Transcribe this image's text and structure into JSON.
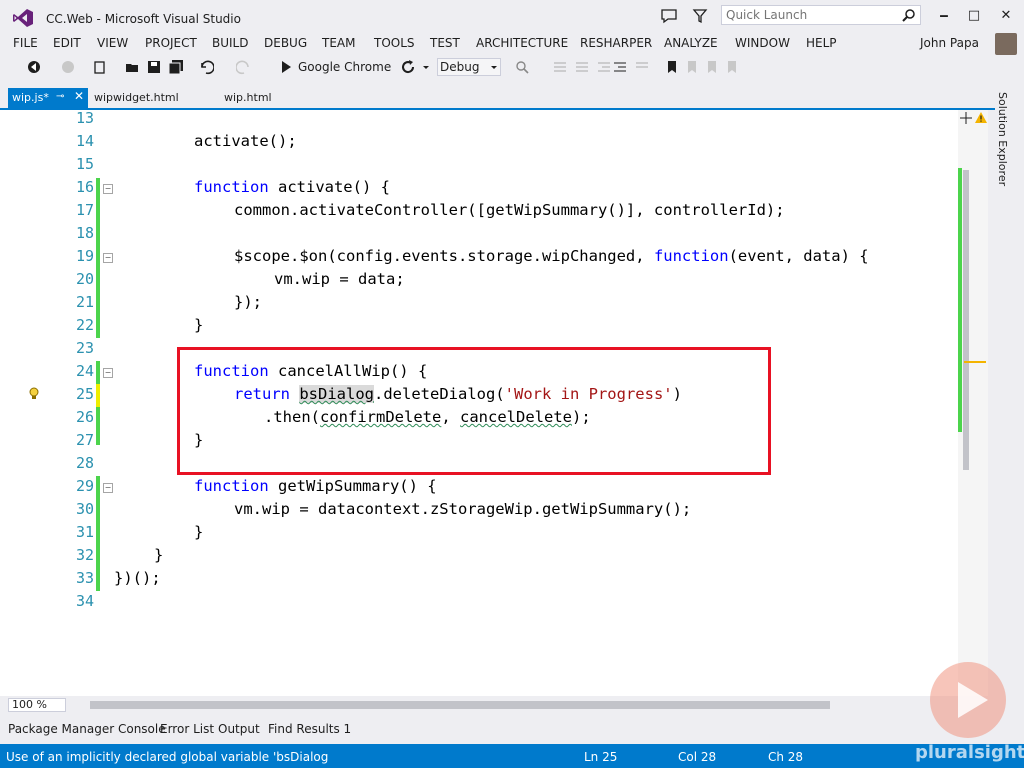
{
  "window": {
    "title": "CC.Web - Microsoft Visual Studio",
    "quick_launch_placeholder": "Quick Launch",
    "minimize": "🗕",
    "maximize": "□",
    "close": "✕"
  },
  "menu": [
    "FILE",
    "EDIT",
    "VIEW",
    "PROJECT",
    "BUILD",
    "DEBUG",
    "TEAM",
    "TOOLS",
    "TEST",
    "ARCHITECTURE",
    "RESHARPER",
    "ANALYZE",
    "WINDOW",
    "HELP"
  ],
  "user": "John Papa",
  "toolbar": {
    "browser": "Google Chrome",
    "config": "Debug"
  },
  "tabs": [
    {
      "label": "wip.js*",
      "active": true
    },
    {
      "label": "wipwidget.html",
      "active": false
    },
    {
      "label": "wip.html",
      "active": false
    }
  ],
  "side_panel": "Solution Explorer",
  "editor": {
    "lines": [
      {
        "n": "13",
        "code": ""
      },
      {
        "n": "14",
        "code": "activate();"
      },
      {
        "n": "15",
        "code": ""
      },
      {
        "n": "16",
        "code": "function activate() {"
      },
      {
        "n": "17",
        "code": "common.activateController([getWipSummary()], controllerId);"
      },
      {
        "n": "18",
        "code": ""
      },
      {
        "n": "19",
        "code": "$scope.$on(config.events.storage.wipChanged, function(event, data) {"
      },
      {
        "n": "20",
        "code": "vm.wip = data;"
      },
      {
        "n": "21",
        "code": "});"
      },
      {
        "n": "22",
        "code": "}"
      },
      {
        "n": "23",
        "code": ""
      },
      {
        "n": "24",
        "code": "function cancelAllWip() {"
      },
      {
        "n": "25",
        "code": "return bsDialog.deleteDialog('Work in Progress')"
      },
      {
        "n": "26",
        "code": ".then(confirmDelete, cancelDelete);"
      },
      {
        "n": "27",
        "code": "}"
      },
      {
        "n": "28",
        "code": ""
      },
      {
        "n": "29",
        "code": "function getWipSummary() {"
      },
      {
        "n": "30",
        "code": "vm.wip = datacontext.zStorageWip.getWipSummary();"
      },
      {
        "n": "31",
        "code": "}"
      },
      {
        "n": "32",
        "code": "}"
      },
      {
        "n": "33",
        "code": "})();"
      },
      {
        "n": "34",
        "code": ""
      }
    ]
  },
  "zoom": "100 %",
  "bottom_tabs": [
    "Package Manager Console",
    "Error List",
    "Output",
    "Find Results 1"
  ],
  "status": {
    "message": "Use of an implicitly declared global variable 'bsDialog",
    "ln": "Ln 25",
    "col": "Col 28",
    "ch": "Ch 28"
  },
  "watermark": "pluralsight",
  "colors": {
    "accent": "#007acc",
    "highlight_box": "#e81123",
    "keyword": "#0000ff",
    "string": "#a31515",
    "line_number": "#2b91af"
  }
}
